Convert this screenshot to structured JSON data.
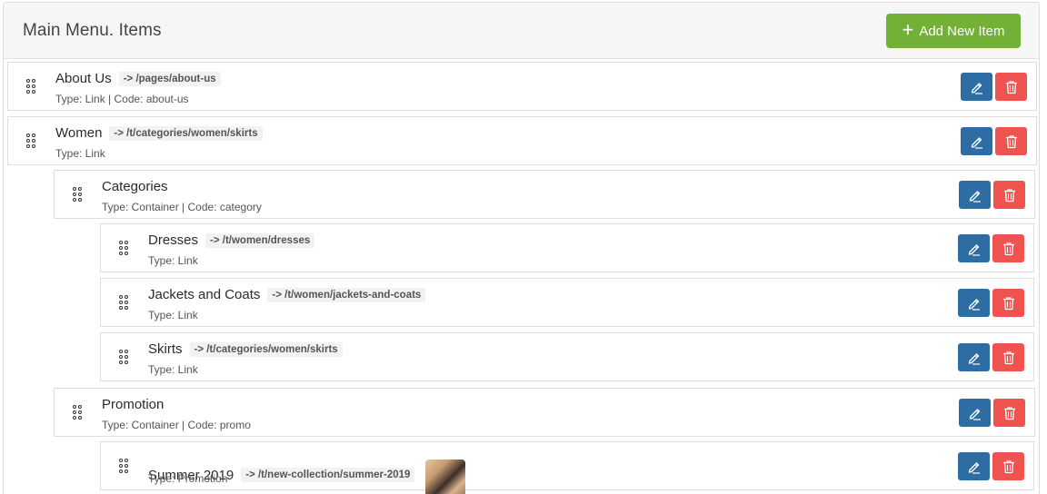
{
  "header": {
    "title": "Main Menu. Items",
    "add_button_label": "Add New Item"
  },
  "items": [
    {
      "title": "About Us",
      "route": "-> /pages/about-us",
      "meta": "Type: Link | Code: about-us"
    },
    {
      "title": "Women",
      "route": "-> /t/categories/women/skirts",
      "meta": "Type: Link"
    },
    {
      "title": "Categories",
      "route": "",
      "meta": "Type: Container | Code: category"
    },
    {
      "title": "Dresses",
      "route": "-> /t/women/dresses",
      "meta": "Type: Link"
    },
    {
      "title": "Jackets and Coats",
      "route": "-> /t/women/jackets-and-coats",
      "meta": "Type: Link"
    },
    {
      "title": "Skirts",
      "route": "-> /t/categories/women/skirts",
      "meta": "Type: Link"
    },
    {
      "title": "Promotion",
      "route": "",
      "meta": "Type: Container | Code: promo"
    },
    {
      "title": "Summer 2019",
      "route": "-> /t/new-collection/summer-2019",
      "meta": "Type: Promotion"
    }
  ],
  "icons": {
    "add": "plus-icon",
    "drag": "drag-handle-icon",
    "edit": "pencil-icon",
    "delete": "trash-icon"
  },
  "colors": {
    "add_button": "#72b036",
    "edit_button": "#2e6da4",
    "delete_button": "#ef5350"
  }
}
